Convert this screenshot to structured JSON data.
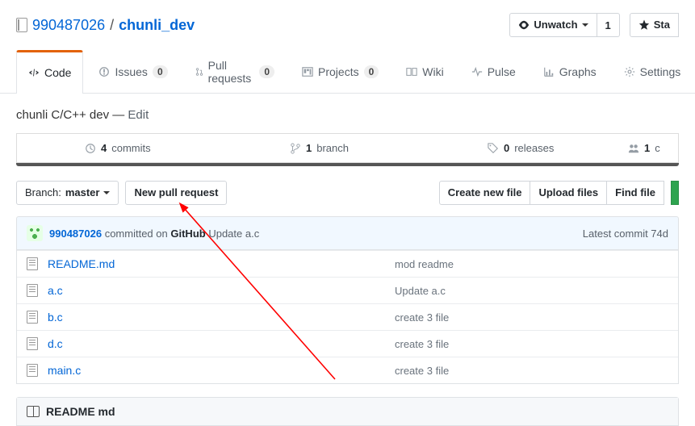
{
  "breadcrumb": {
    "owner": "990487026",
    "sep": "/",
    "repo": "chunli_dev"
  },
  "actions": {
    "unwatch": "Unwatch",
    "unwatch_count": "1",
    "star": "Sta"
  },
  "tabs": {
    "code": "Code",
    "issues": "Issues",
    "issues_count": "0",
    "pulls": "Pull requests",
    "pulls_count": "0",
    "projects": "Projects",
    "projects_count": "0",
    "wiki": "Wiki",
    "pulse": "Pulse",
    "graphs": "Graphs",
    "settings": "Settings"
  },
  "description": {
    "text": "chunli C/C++ dev",
    "dash": "—",
    "edit": "Edit"
  },
  "stats": {
    "commits_n": "4",
    "commits_l": "commits",
    "branches_n": "1",
    "branches_l": "branch",
    "releases_n": "0",
    "releases_l": "releases",
    "contrib_n": "1",
    "contrib_l": "c"
  },
  "filenav": {
    "branch_lbl": "Branch:",
    "branch_val": "master",
    "new_pr": "New pull request",
    "create_file": "Create new file",
    "upload": "Upload files",
    "find": "Find file"
  },
  "commit": {
    "author": "990487026",
    "mid": "committed on",
    "where": "GitHub",
    "msg": "Update a.c",
    "latest": "Latest commit 74d"
  },
  "files": [
    {
      "name": "README.md",
      "msg": "mod readme"
    },
    {
      "name": "a.c",
      "msg": "Update a.c"
    },
    {
      "name": "b.c",
      "msg": "create 3 file"
    },
    {
      "name": "d.c",
      "msg": "create 3 file"
    },
    {
      "name": "main.c",
      "msg": "create 3 file"
    }
  ],
  "readme": {
    "title": "README md"
  }
}
